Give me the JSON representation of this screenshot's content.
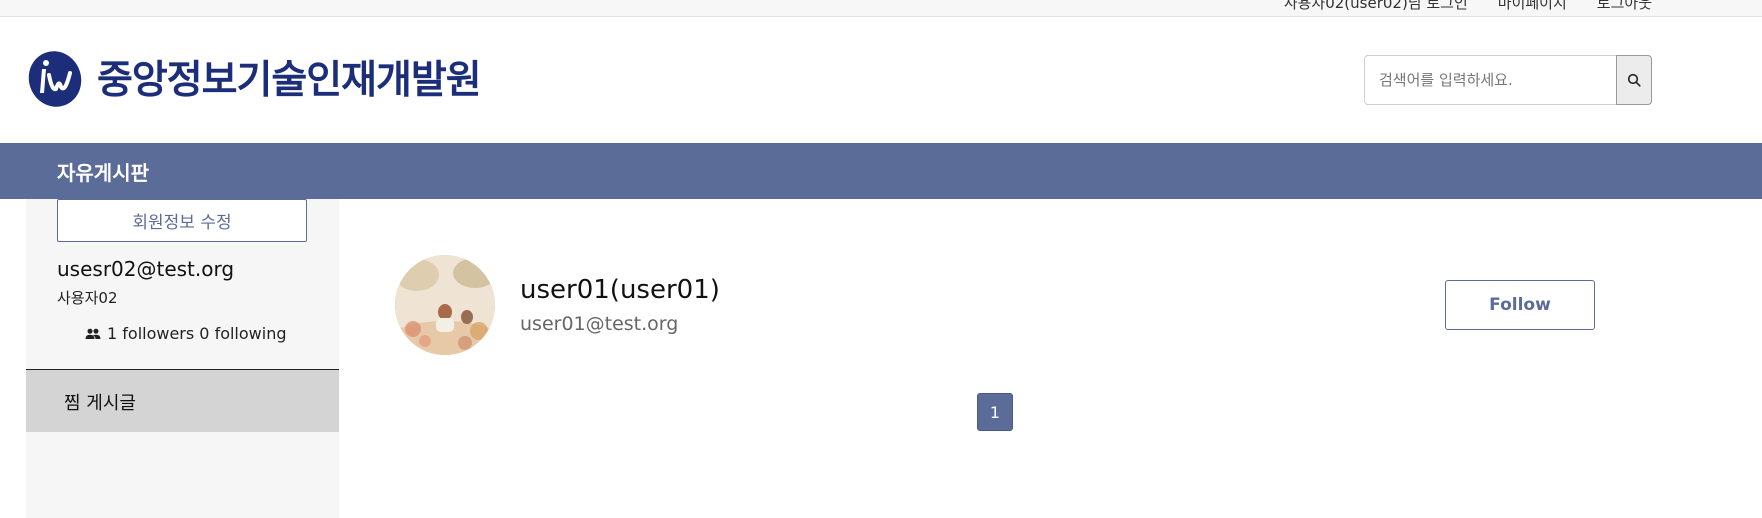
{
  "topbar": {
    "links": [
      "사용자02(user02)님 로그인",
      "마이페이지",
      "로그아웃"
    ]
  },
  "header": {
    "logo_text": "중앙정보기술인재개발원",
    "search": {
      "placeholder": "검색어를 입력하세요.",
      "value": ""
    },
    "search_icon": "search-icon"
  },
  "nav": {
    "items": [
      "자유게시판"
    ]
  },
  "sidebar": {
    "edit_profile_label": "회원정보 수정",
    "email": "usesr02@test.org",
    "name": "사용자02",
    "follow_stats": "1 followers 0 following",
    "follow_icon": "people-icon",
    "menu": [
      {
        "label": "찜 게시글"
      }
    ]
  },
  "main": {
    "user": {
      "name": "user01(user01)",
      "email": "user01@test.org",
      "follow_label": "Follow"
    },
    "pagination": {
      "pages": [
        "1"
      ],
      "current": "1"
    }
  },
  "colors": {
    "accent": "#5b6c98",
    "logo": "#1c2e7a",
    "sidebar_bg": "#f6f6f6",
    "menu_active_bg": "#d4d4d4"
  }
}
